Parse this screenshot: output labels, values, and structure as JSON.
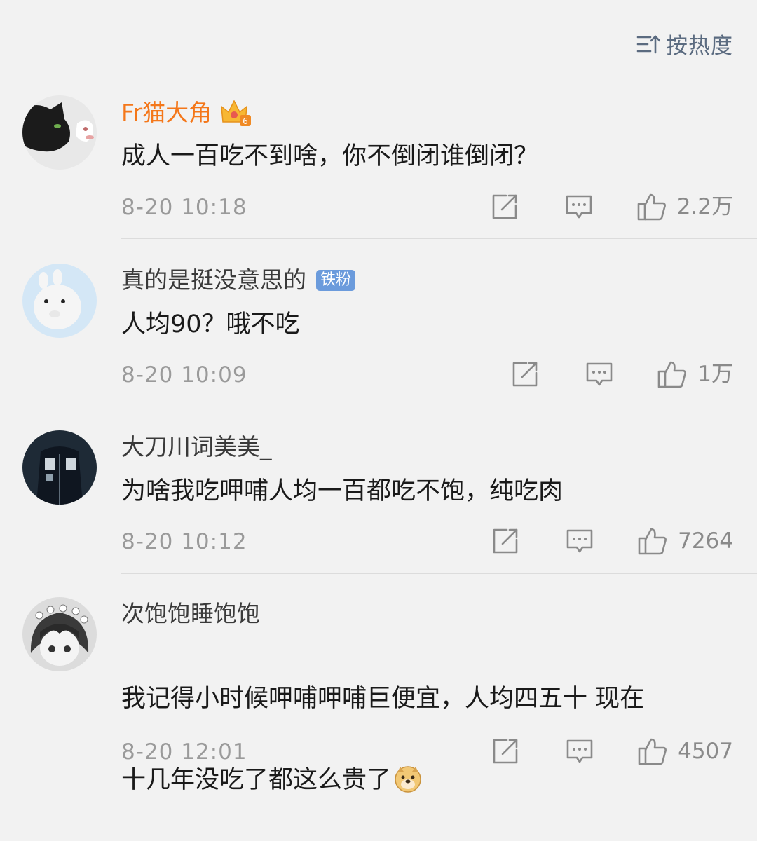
{
  "sort": {
    "label": "按热度"
  },
  "comments": [
    {
      "username": "Fr猫大角",
      "text": "成人一百吃不到啥，你不倒闭谁倒闭？",
      "time": "8-20 10:18",
      "likes": "2.2万"
    },
    {
      "username": "真的是挺没意思的",
      "badge": "铁粉",
      "text": "人均90？哦不吃",
      "time": "8-20 10:09",
      "likes": "1万"
    },
    {
      "username": "大刀川词美美_",
      "text": "为啥我吃呷哺人均一百都吃不饱，纯吃肉",
      "time": "8-20 10:12",
      "likes": "7264"
    },
    {
      "username": "次饱饱睡饱饱",
      "text_line1": "我记得小时候呷哺呷哺巨便宜，人均四五十 现在",
      "text_line2": "十几年没吃了都这么贵了",
      "time": "8-20 12:01",
      "likes": "4507"
    }
  ],
  "colors": {
    "background": "#f2f2f2",
    "vip_name": "#f4771a",
    "fan_badge": "#6b9bdc",
    "meta_text": "#9a9a9a",
    "sort_text": "#5b6b80"
  }
}
